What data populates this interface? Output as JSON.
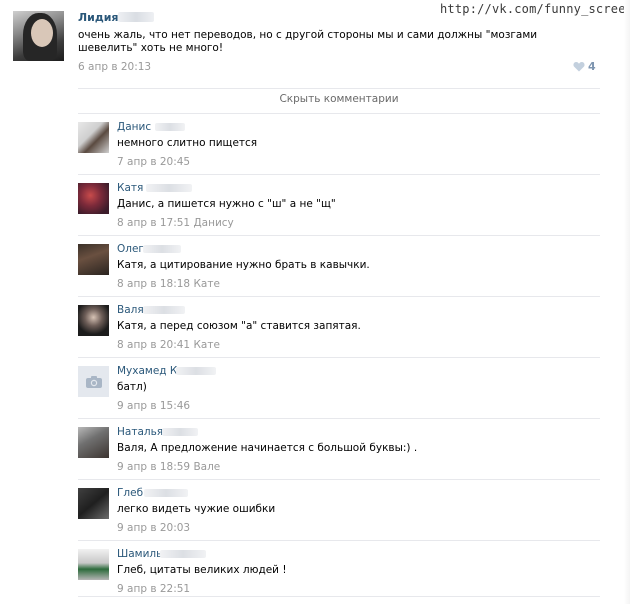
{
  "watermark": "http://vk.com/funny_screen",
  "post": {
    "author": "Лидия",
    "text": "очень жаль, что нет переводов, но с другой стороны мы и сами должны \"мозгами шевелить\" хоть не много!",
    "date": "6 апр в 20:13",
    "likes": "4",
    "like_icon": "heart-icon"
  },
  "hide_comments": "Скрыть комментарии",
  "comments": [
    {
      "name": "Данис",
      "text": "немного слитно пищется",
      "date": "7 апр в 20:45"
    },
    {
      "name": "Катя",
      "text": "Данис, а пишется нужно с \"ш\" а не \"щ\"",
      "date": "8 апр в 17:51 Данису"
    },
    {
      "name": "Олег",
      "text": "Катя, а цитирование нужно брать в кавычки.",
      "date": "8 апр в 18:18 Кате"
    },
    {
      "name": "Валя",
      "text": "Катя, а перед союзом \"а\" ставится запятая.",
      "date": "8 апр в 20:41 Кате"
    },
    {
      "name": "Мухамед К",
      "text": "батл)",
      "date": "9 апр в 15:46"
    },
    {
      "name": "Наталья",
      "text": "Валя, А предложение начинается с большой буквы:) .",
      "date": "9 апр в 18:59 Вале"
    },
    {
      "name": "Глеб",
      "text": "легко видеть чужие ошибки",
      "date": "9 апр в 20:03"
    },
    {
      "name": "Шамиль",
      "text": "Глеб, цитаты великих людей !",
      "date": "9 апр в 22:51"
    }
  ],
  "colors": {
    "link": "#2b587a",
    "meta": "#999999",
    "divider": "#e7e8ec",
    "likes": "#7e95b0"
  }
}
